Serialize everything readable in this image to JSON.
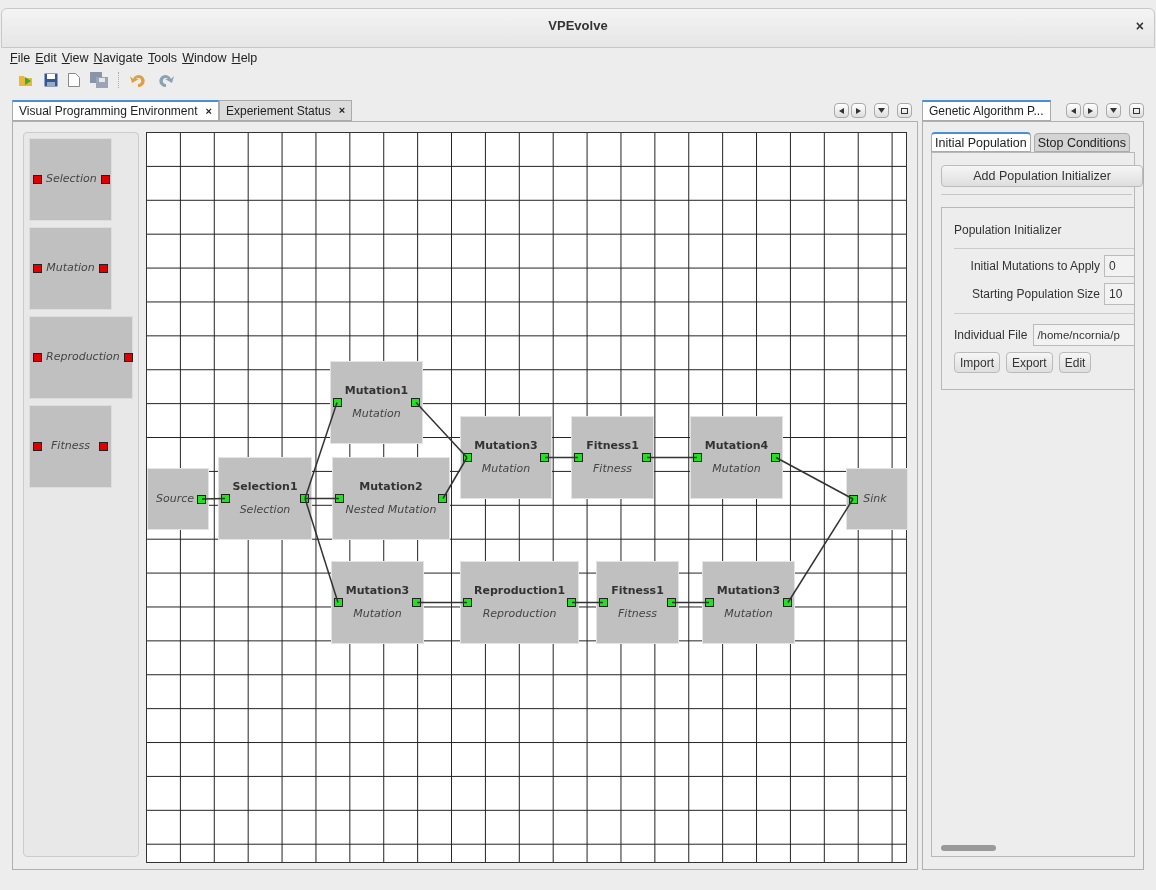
{
  "window": {
    "title": "VPEvolve",
    "close": "×"
  },
  "menu": [
    "File",
    "Edit",
    "View",
    "Navigate",
    "Tools",
    "Window",
    "Help"
  ],
  "editor_tabs": [
    {
      "label": "Visual Programming Environment",
      "close": "×",
      "selected": true
    },
    {
      "label": "Experiement Status",
      "close": "×",
      "selected": false
    }
  ],
  "palette": [
    {
      "type": "Selection"
    },
    {
      "type": "Mutation"
    },
    {
      "type": "Reproduction"
    },
    {
      "type": "Fitness"
    }
  ],
  "nodes": [
    {
      "kind": "source",
      "type": "Source"
    },
    {
      "kind": "node",
      "name": "Selection1",
      "type": "Selection"
    },
    {
      "kind": "node",
      "name": "Mutation1",
      "type": "Mutation"
    },
    {
      "kind": "node",
      "name": "Mutation2",
      "type": "Nested Mutation"
    },
    {
      "kind": "node",
      "name": "Mutation3",
      "type": "Mutation"
    },
    {
      "kind": "node",
      "name": "Fitness1",
      "type": "Fitness"
    },
    {
      "kind": "node",
      "name": "Mutation4",
      "type": "Mutation"
    },
    {
      "kind": "sink",
      "type": "Sink"
    },
    {
      "kind": "node",
      "name": "Mutation3",
      "type": "Mutation"
    },
    {
      "kind": "node",
      "name": "Reproduction1",
      "type": "Reproduction"
    },
    {
      "kind": "node",
      "name": "Fitness1",
      "type": "Fitness"
    },
    {
      "kind": "node",
      "name": "Mutation3",
      "type": "Mutation"
    }
  ],
  "side_panel": {
    "tab": {
      "label": "Genetic Algorithm P...",
      "selected": true
    },
    "tabs": [
      {
        "label": "Initial Population",
        "selected": true
      },
      {
        "label": "Stop Conditions",
        "selected": false
      }
    ],
    "add_button": "Add Population Initializer",
    "group": {
      "title": "Population Initializer",
      "fields": [
        {
          "label": "Initial Mutations to Apply",
          "value": "0"
        },
        {
          "label": "Starting Population Size",
          "value": "10"
        }
      ],
      "file": {
        "label": "Individual File",
        "value": "/home/ncornia/p"
      },
      "buttons": [
        "Import",
        "Export",
        "Edit"
      ]
    }
  }
}
